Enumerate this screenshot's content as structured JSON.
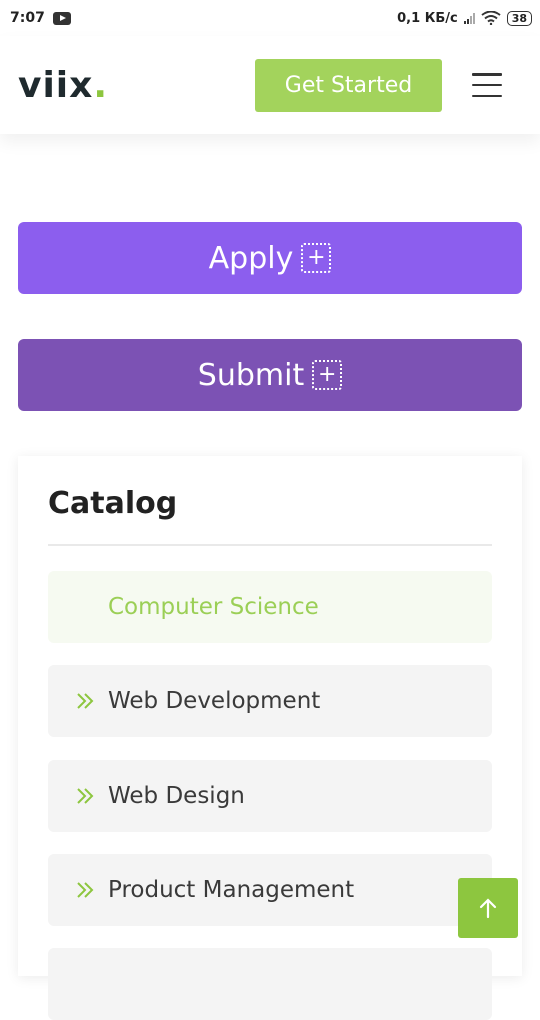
{
  "status_bar": {
    "time": "7:07",
    "network_speed": "0,1 КБ/с",
    "battery": "38",
    "icons": [
      "youtube-icon",
      "signal-icon",
      "wifi-icon",
      "battery-icon"
    ]
  },
  "header": {
    "logo_text": "viix",
    "logo_dot": ".",
    "get_started_label": "Get Started",
    "menu_icon": "hamburger-icon"
  },
  "actions": {
    "apply_label": "Apply",
    "submit_label": "Submit",
    "plus_glyph": "+"
  },
  "catalog": {
    "title": "Catalog",
    "items": [
      {
        "label": "Computer Science",
        "active": true
      },
      {
        "label": "Web Development",
        "active": false
      },
      {
        "label": "Web Design",
        "active": false
      },
      {
        "label": "Product Management",
        "active": false
      }
    ]
  },
  "colors": {
    "accent_green": "#8dc63f",
    "apply_purple": "#8c5eee",
    "submit_purple": "#7c52b4"
  }
}
